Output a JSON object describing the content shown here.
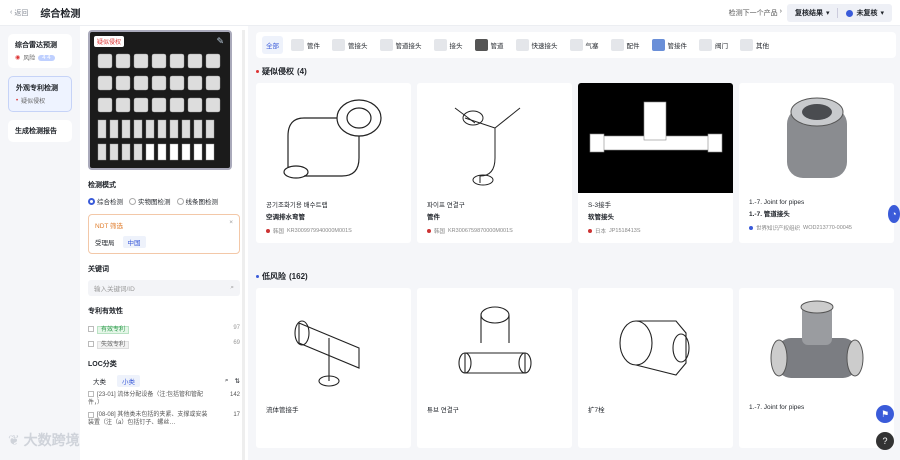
{
  "header": {
    "back": "返回",
    "title": "综合检测",
    "next": "检测下一个产品",
    "review_result": "复核结果",
    "review_status": "未复核"
  },
  "leftnav": [
    {
      "title": "综合雷达预测",
      "sub_label": "风险",
      "pill": "4 4"
    },
    {
      "title": "外观专利检测",
      "sub_label": "疑似侵权"
    },
    {
      "title": "生成检测报告"
    }
  ],
  "panel": {
    "sample_badge": "疑似侵权",
    "mode_label": "检测模式",
    "modes": [
      "综合检测",
      "实物图检测",
      "线条图检测"
    ],
    "ndt_title": "NDT 筛选",
    "ndt_field": "受理局",
    "ndt_value": "中国",
    "kw_label": "关键词",
    "kw_placeholder": "输入关键词/ID",
    "validity_label": "专利有效性",
    "validity": [
      {
        "label": "有效专利",
        "count": "97"
      },
      {
        "label": "失效专利",
        "count": "69"
      }
    ],
    "loc_label": "LOC分类",
    "loc_tabs": [
      "大类",
      "小类"
    ],
    "loc_items": [
      {
        "text": "[23-01] 流体分配设备（注:包括管和管配件，）",
        "count": "142"
      },
      {
        "text": "[08-08] 其他类未包括的夹紧、支撑或安装装置（注（a）包括钉子、螺丝…",
        "count": "17"
      }
    ]
  },
  "categories": [
    "全部",
    "管件",
    "管接头",
    "管道接头",
    "接头",
    "管道",
    "快速接头",
    "气塞",
    "配件",
    "管接件",
    "阀门",
    "其他"
  ],
  "groups": [
    {
      "title": "疑似侵权",
      "count": "(4)",
      "cards": [
        {
          "t1": "공기조화기용 배수트랩",
          "t2": "空调排水弯管",
          "country": "韩国",
          "id": "KR3009979940000M001S"
        },
        {
          "t1": "파이프 연결구",
          "t2": "管件",
          "country": "韩国",
          "id": "KR3006759870000M001S"
        },
        {
          "t1": "S-3接手",
          "t2": "软管接头",
          "country": "日本",
          "id": "JP1518413S"
        },
        {
          "t1": "1.-7. Joint for pipes",
          "t2": "1.-7. 管道接头",
          "country": "世界知识产权组织",
          "id": "WOD213770-00045"
        }
      ]
    },
    {
      "title": "低风险",
      "count": "(162)",
      "cards": [
        {
          "t1": "流体管接手",
          "t2": ""
        },
        {
          "t1": "튜브 연결구",
          "t2": ""
        },
        {
          "t1": "扩7栓",
          "t2": ""
        },
        {
          "t1": "1.-7. Joint for pipes",
          "t2": ""
        }
      ]
    }
  ],
  "brand": "大数跨境"
}
